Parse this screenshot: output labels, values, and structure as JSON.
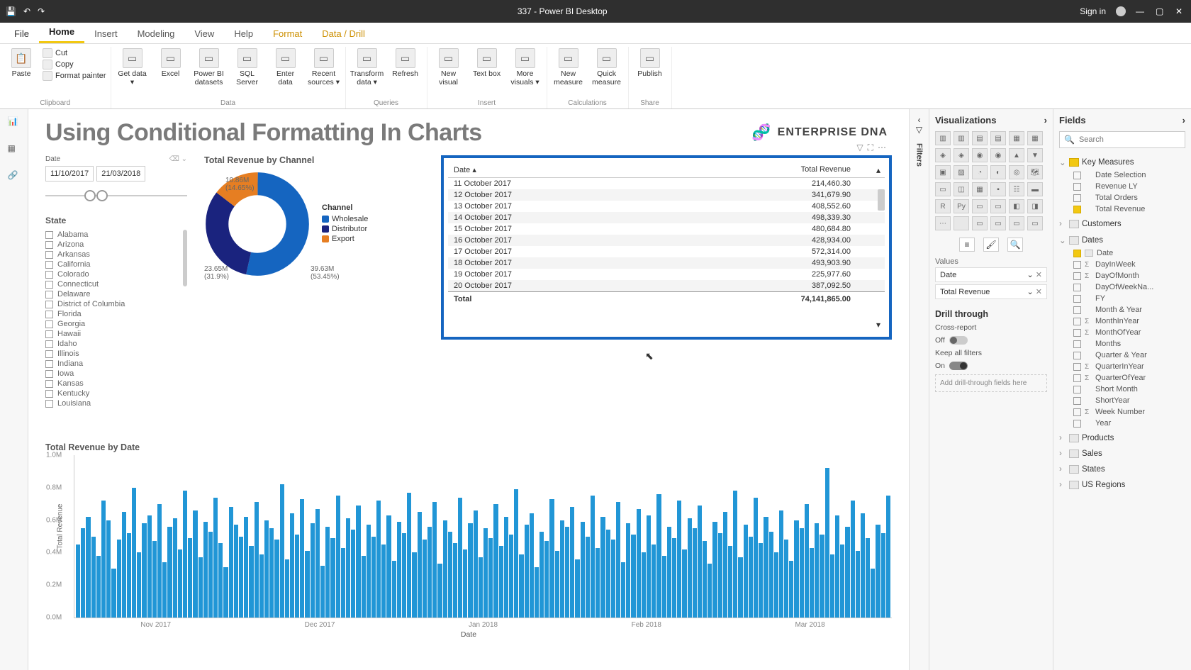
{
  "titlebar": {
    "title": "337 - Power BI Desktop",
    "signin": "Sign in"
  },
  "menu": {
    "tabs": [
      "File",
      "Home",
      "Insert",
      "Modeling",
      "View",
      "Help",
      "Format",
      "Data / Drill"
    ],
    "active": 1
  },
  "ribbon": {
    "clipboard": {
      "paste": "Paste",
      "cut": "Cut",
      "copy": "Copy",
      "painter": "Format painter",
      "label": "Clipboard"
    },
    "data": {
      "items": [
        "Get data ▾",
        "Excel",
        "Power BI datasets",
        "SQL Server",
        "Enter data",
        "Recent sources ▾"
      ],
      "label": "Data"
    },
    "queries": {
      "items": [
        "Transform data ▾",
        "Refresh"
      ],
      "label": "Queries"
    },
    "insert": {
      "items": [
        "New visual",
        "Text box",
        "More visuals ▾"
      ],
      "label": "Insert"
    },
    "calc": {
      "items": [
        "New measure",
        "Quick measure"
      ],
      "label": "Calculations"
    },
    "share": {
      "items": [
        "Publish"
      ],
      "label": "Share"
    }
  },
  "report": {
    "title": "Using Conditional Formatting In Charts",
    "logo_text": "ENTERPRISE DNA",
    "date_slicer": {
      "label": "Date",
      "from": "11/10/2017",
      "to": "21/03/2018"
    },
    "state": {
      "title": "State",
      "items": [
        "Alabama",
        "Arizona",
        "Arkansas",
        "California",
        "Colorado",
        "Connecticut",
        "Delaware",
        "District of Columbia",
        "Florida",
        "Georgia",
        "Hawaii",
        "Idaho",
        "Illinois",
        "Indiana",
        "Iowa",
        "Kansas",
        "Kentucky",
        "Louisiana"
      ]
    },
    "donut": {
      "title": "Total Revenue by Channel",
      "legend_title": "Channel",
      "series": [
        {
          "name": "Wholesale",
          "value": 39.63,
          "pct": "53.45%",
          "color": "#1565c0"
        },
        {
          "name": "Distributor",
          "value": 23.65,
          "pct": "31.9%",
          "color": "#1a237e"
        },
        {
          "name": "Export",
          "value": 10.86,
          "pct": "14.65%",
          "color": "#e67e22"
        }
      ],
      "labels": [
        "10.86M",
        "(14.65%)",
        "23.65M",
        "(31.9%)",
        "39.63M",
        "(53.45%)"
      ]
    },
    "table": {
      "headers": [
        "Date",
        "Total Revenue"
      ],
      "rows": [
        [
          "11 October 2017",
          "214,460.30"
        ],
        [
          "12 October 2017",
          "341,679.90"
        ],
        [
          "13 October 2017",
          "408,552.60"
        ],
        [
          "14 October 2017",
          "498,339.30"
        ],
        [
          "15 October 2017",
          "480,684.80"
        ],
        [
          "16 October 2017",
          "428,934.00"
        ],
        [
          "17 October 2017",
          "572,314.00"
        ],
        [
          "18 October 2017",
          "493,903.90"
        ],
        [
          "19 October 2017",
          "225,977.60"
        ],
        [
          "20 October 2017",
          "387,092.50"
        ]
      ],
      "total_label": "Total",
      "total_value": "74,141,865.00"
    },
    "barchart": {
      "title": "Total Revenue by Date",
      "ylabels": [
        "1.0M",
        "0.8M",
        "0.6M",
        "0.4M",
        "0.2M",
        "0.0M"
      ],
      "xlabels": [
        "Nov 2017",
        "Dec 2017",
        "Jan 2018",
        "Feb 2018",
        "Mar 2018"
      ],
      "yaxis": "Total Revenue",
      "xaxis": "Date"
    }
  },
  "viz": {
    "title": "Visualizations",
    "values_label": "Values",
    "wells": [
      "Date",
      "Total Revenue"
    ],
    "drill_label": "Drill through",
    "cross": "Cross-report",
    "cross_state": "Off",
    "keep": "Keep all filters",
    "keep_state": "On",
    "dropzone": "Add drill-through fields here"
  },
  "fields": {
    "title": "Fields",
    "search_ph": "Search",
    "tables": [
      {
        "name": "Key Measures",
        "expanded": true,
        "km": true,
        "fields": [
          {
            "n": "Date Selection",
            "c": false
          },
          {
            "n": "Revenue LY",
            "c": false
          },
          {
            "n": "Total Orders",
            "c": false
          },
          {
            "n": "Total Revenue",
            "c": true
          }
        ]
      },
      {
        "name": "Customers",
        "expanded": false
      },
      {
        "name": "Dates",
        "expanded": true,
        "fields": [
          {
            "n": "Date",
            "c": true,
            "date": true
          },
          {
            "n": "DayInWeek",
            "c": false,
            "sig": true
          },
          {
            "n": "DayOfMonth",
            "c": false,
            "sig": true
          },
          {
            "n": "DayOfWeekNa...",
            "c": false
          },
          {
            "n": "FY",
            "c": false
          },
          {
            "n": "Month & Year",
            "c": false
          },
          {
            "n": "MonthInYear",
            "c": false,
            "sig": true
          },
          {
            "n": "MonthOfYear",
            "c": false,
            "sig": true
          },
          {
            "n": "Months",
            "c": false
          },
          {
            "n": "Quarter & Year",
            "c": false
          },
          {
            "n": "QuarterInYear",
            "c": false,
            "sig": true
          },
          {
            "n": "QuarterOfYear",
            "c": false,
            "sig": true
          },
          {
            "n": "Short Month",
            "c": false
          },
          {
            "n": "ShortYear",
            "c": false
          },
          {
            "n": "Week Number",
            "c": false,
            "sig": true
          },
          {
            "n": "Year",
            "c": false
          }
        ]
      },
      {
        "name": "Products",
        "expanded": false
      },
      {
        "name": "Sales",
        "expanded": false
      },
      {
        "name": "States",
        "expanded": false
      },
      {
        "name": "US Regions",
        "expanded": false
      }
    ]
  },
  "filters_label": "Filters",
  "chart_data": {
    "donut": {
      "type": "pie",
      "title": "Total Revenue by Channel",
      "series": [
        {
          "name": "Wholesale",
          "value": 39.63,
          "pct": 53.45
        },
        {
          "name": "Distributor",
          "value": 23.65,
          "pct": 31.9
        },
        {
          "name": "Export",
          "value": 10.86,
          "pct": 14.65
        }
      ],
      "unit": "M"
    },
    "table_visual": {
      "type": "table",
      "columns": [
        "Date",
        "Total Revenue"
      ],
      "rows": [
        [
          "11 October 2017",
          214460.3
        ],
        [
          "12 October 2017",
          341679.9
        ],
        [
          "13 October 2017",
          408552.6
        ],
        [
          "14 October 2017",
          498339.3
        ],
        [
          "15 October 2017",
          480684.8
        ],
        [
          "16 October 2017",
          428934.0
        ],
        [
          "17 October 2017",
          572314.0
        ],
        [
          "18 October 2017",
          493903.9
        ],
        [
          "19 October 2017",
          225977.6
        ],
        [
          "20 October 2017",
          387092.5
        ]
      ],
      "total": 74141865.0
    },
    "bar": {
      "type": "bar",
      "title": "Total Revenue by Date",
      "xlabel": "Date",
      "ylabel": "Total Revenue",
      "ylim": [
        0,
        1000000
      ],
      "x_range": [
        "2017-10-11",
        "2018-03-21"
      ],
      "x_ticks": [
        "Nov 2017",
        "Dec 2017",
        "Jan 2018",
        "Feb 2018",
        "Mar 2018"
      ],
      "note": "~160 daily bars; values approx 0.15M–0.95M, mean ~0.46M",
      "sample_values_M": [
        0.45,
        0.55,
        0.62,
        0.5,
        0.38,
        0.72,
        0.6,
        0.3,
        0.48,
        0.65,
        0.52,
        0.8,
        0.4,
        0.58,
        0.63,
        0.47,
        0.7,
        0.34,
        0.56,
        0.61,
        0.42,
        0.78,
        0.49,
        0.66,
        0.37,
        0.59,
        0.53,
        0.74,
        0.46,
        0.31,
        0.68,
        0.57,
        0.5,
        0.62,
        0.44,
        0.71,
        0.39,
        0.6,
        0.55,
        0.48,
        0.82,
        0.36,
        0.64,
        0.51,
        0.73,
        0.41,
        0.58,
        0.67,
        0.32,
        0.56,
        0.49,
        0.75,
        0.43,
        0.61,
        0.54,
        0.69,
        0.38,
        0.57,
        0.5,
        0.72,
        0.45,
        0.63,
        0.35,
        0.59,
        0.52,
        0.77,
        0.4,
        0.65,
        0.48,
        0.56,
        0.71,
        0.33,
        0.6,
        0.53,
        0.46,
        0.74,
        0.42,
        0.58,
        0.66,
        0.37,
        0.55,
        0.49,
        0.7,
        0.44,
        0.62,
        0.51,
        0.79,
        0.39,
        0.57,
        0.64,
        0.31,
        0.53,
        0.47,
        0.73,
        0.41,
        0.6,
        0.56,
        0.68,
        0.36,
        0.59,
        0.5,
        0.75,
        0.43,
        0.62,
        0.54,
        0.48,
        0.71,
        0.34,
        0.58,
        0.51,
        0.67,
        0.4,
        0.63,
        0.45,
        0.76,
        0.38,
        0.56,
        0.49,
        0.72,
        0.42,
        0.61,
        0.55,
        0.69,
        0.47,
        0.33,
        0.59,
        0.52,
        0.65,
        0.44,
        0.78,
        0.37,
        0.57,
        0.5,
        0.74,
        0.46,
        0.62,
        0.53,
        0.4,
        0.66,
        0.48,
        0.35,
        0.6,
        0.55,
        0.7,
        0.43,
        0.58,
        0.51,
        0.92,
        0.39,
        0.63,
        0.45,
        0.56,
        0.72,
        0.41,
        0.64,
        0.49,
        0.3,
        0.57,
        0.52,
        0.75
      ]
    }
  }
}
